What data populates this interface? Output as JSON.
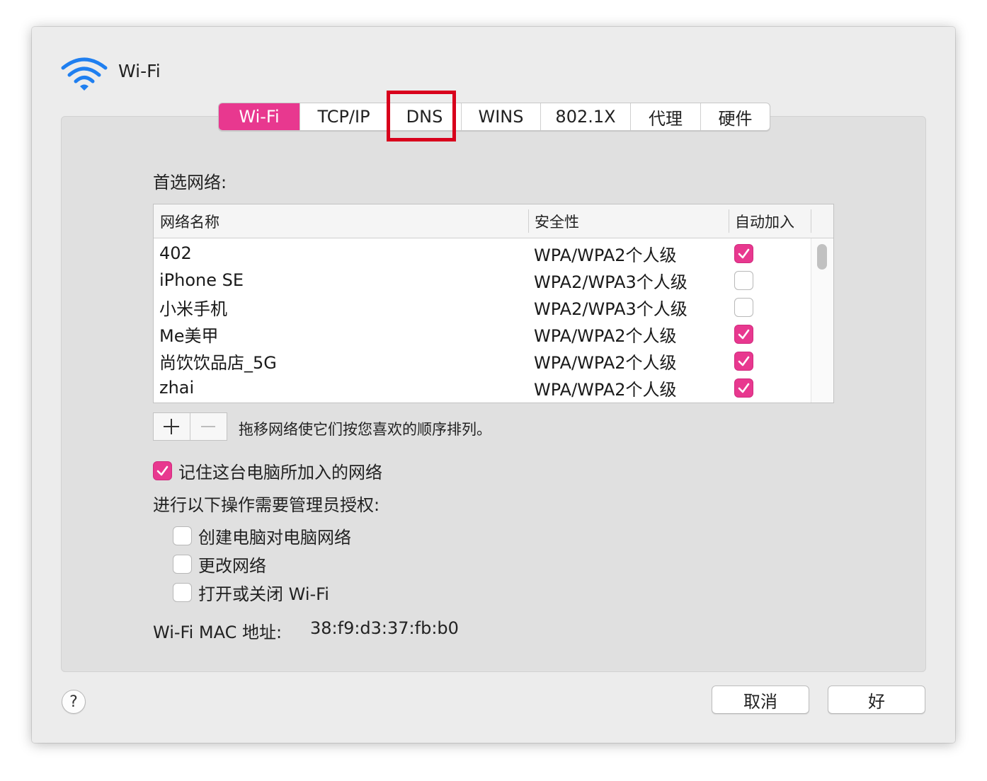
{
  "window": {
    "title": "Wi-Fi",
    "icon": "wifi-icon"
  },
  "tabs": [
    {
      "label": "Wi-Fi",
      "active": true
    },
    {
      "label": "TCP/IP",
      "active": false
    },
    {
      "label": "DNS",
      "active": false
    },
    {
      "label": "WINS",
      "active": false
    },
    {
      "label": "802.1X",
      "active": false
    },
    {
      "label": "代理",
      "active": false
    },
    {
      "label": "硬件",
      "active": false
    }
  ],
  "preferred": {
    "label": "首选网络:",
    "columns": [
      "网络名称",
      "安全性",
      "自动加入"
    ],
    "rows": [
      {
        "name": "402",
        "security": "WPA/WPA2个人级",
        "auto_join": true
      },
      {
        "name": "iPhone SE",
        "security": "WPA2/WPA3个人级",
        "auto_join": false
      },
      {
        "name": "小米手机",
        "security": "WPA2/WPA3个人级",
        "auto_join": false
      },
      {
        "name": "Me美甲",
        "security": "WPA/WPA2个人级",
        "auto_join": true
      },
      {
        "name": "尚饮饮品店_5G",
        "security": "WPA/WPA2个人级",
        "auto_join": true
      },
      {
        "name": "zhai",
        "security": "WPA/WPA2个人级",
        "auto_join": true
      }
    ],
    "hint": "拖移网络使它们按您喜欢的顺序排列。"
  },
  "remember": {
    "label": "记住这台电脑所加入的网络",
    "checked": true
  },
  "admin": {
    "label": "进行以下操作需要管理员授权:",
    "options": [
      {
        "label": "创建电脑对电脑网络",
        "checked": false
      },
      {
        "label": "更改网络",
        "checked": false
      },
      {
        "label": "打开或关闭 Wi-Fi",
        "checked": false
      }
    ]
  },
  "mac": {
    "label": "Wi-Fi MAC 地址:",
    "value": "38:f9:d3:37:fb:b0"
  },
  "footer": {
    "help": "?",
    "cancel": "取消",
    "ok": "好"
  },
  "colors": {
    "accent": "#e8388f",
    "highlight": "#d8001c"
  }
}
